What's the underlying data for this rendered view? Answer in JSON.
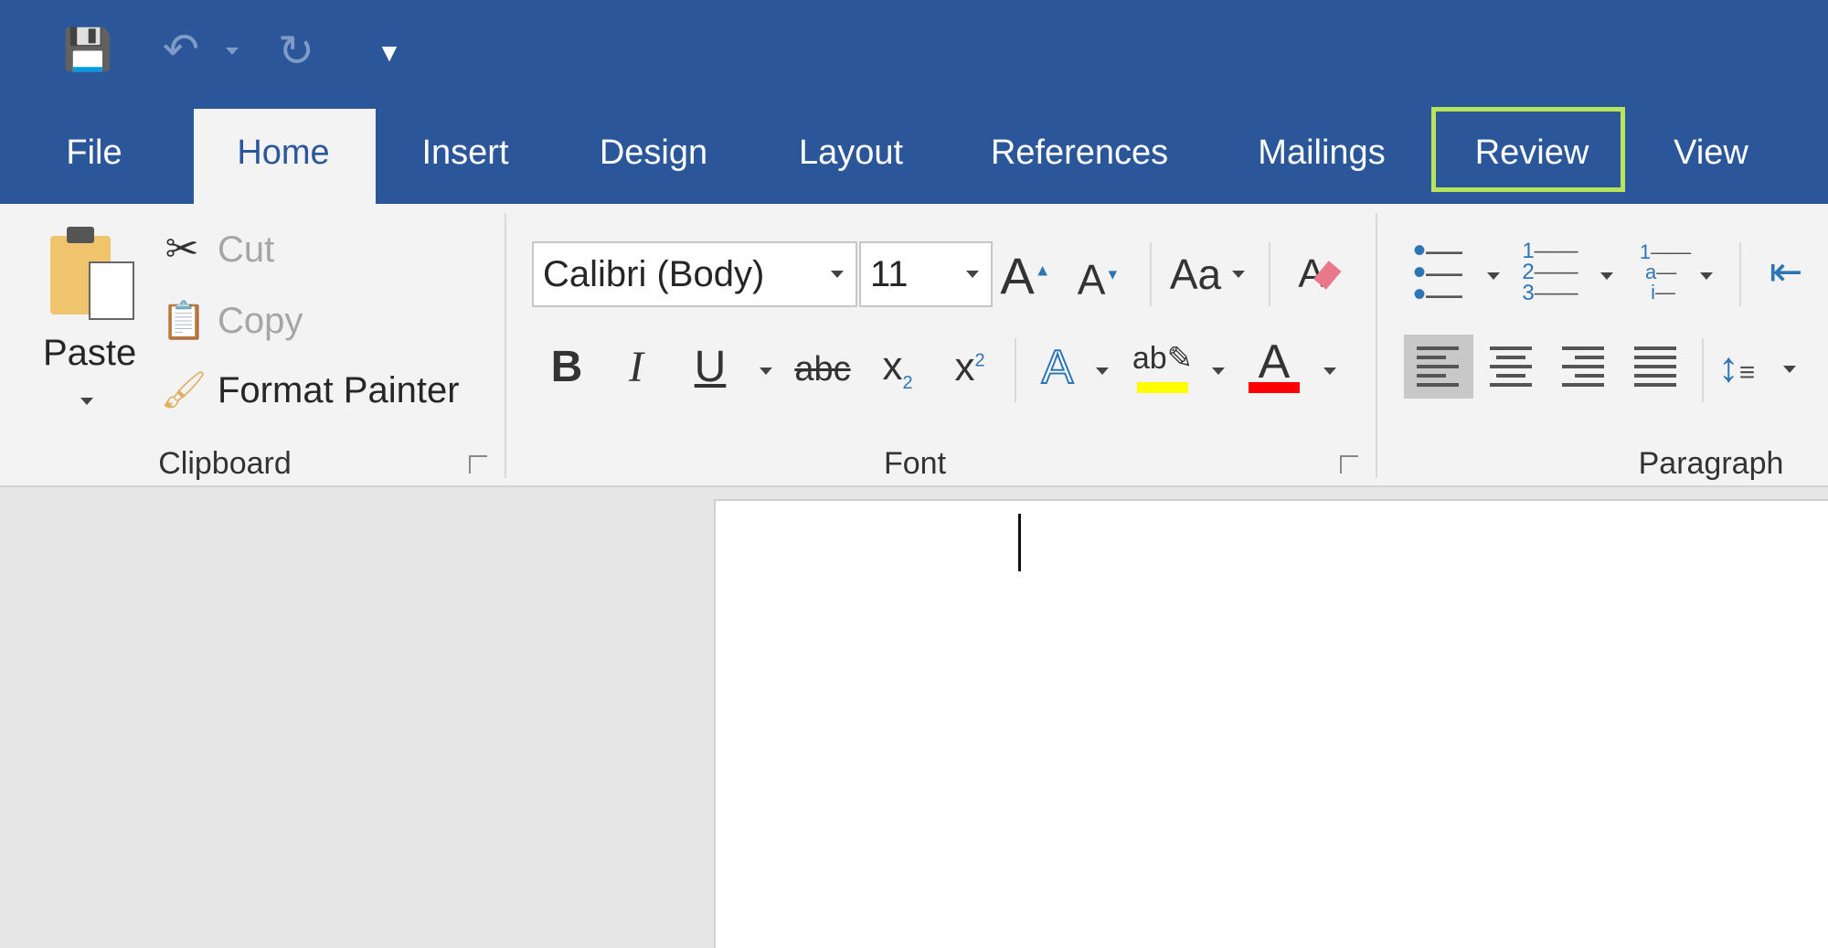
{
  "quick_access": {
    "icons": [
      "save-icon",
      "undo-icon",
      "redo-icon",
      "customize-icon"
    ]
  },
  "tabs": [
    {
      "label": "File"
    },
    {
      "label": "Home",
      "active": true
    },
    {
      "label": "Insert"
    },
    {
      "label": "Design"
    },
    {
      "label": "Layout"
    },
    {
      "label": "References"
    },
    {
      "label": "Mailings"
    },
    {
      "label": "Review",
      "highlighted": true
    },
    {
      "label": "View"
    }
  ],
  "clipboard": {
    "paste": "Paste",
    "cut": "Cut",
    "copy": "Copy",
    "format_painter": "Format Painter",
    "group_label": "Clipboard"
  },
  "font": {
    "font_name": "Calibri (Body)",
    "font_size": "11",
    "change_case": "Aa",
    "group_label": "Font",
    "highlight_color": "#ffff00",
    "font_color": "#ff0000"
  },
  "paragraph": {
    "group_label": "Paragraph"
  },
  "colors": {
    "title_bar": "#2b579a",
    "ribbon": "#f3f3f3",
    "highlight_box": "#b8e35a",
    "canvas": "#e6e6e6"
  }
}
